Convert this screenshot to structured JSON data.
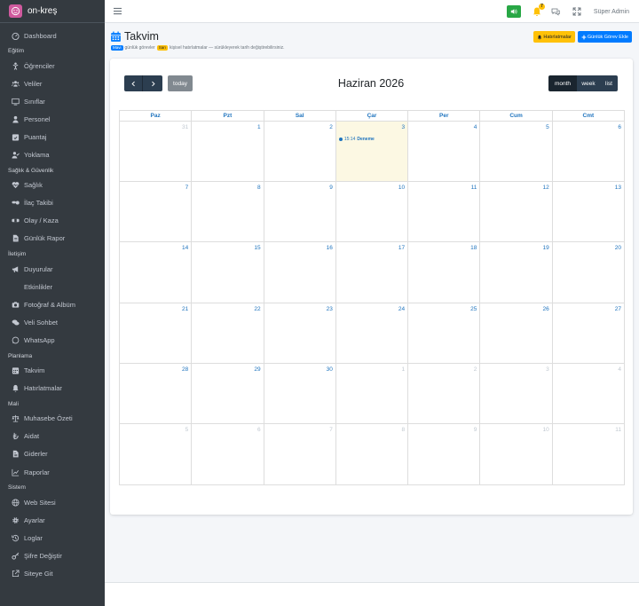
{
  "app": {
    "brand": "on-kreş",
    "user": "Süper Admin",
    "notification_count": "7"
  },
  "sidebar": {
    "sections": [
      {
        "header": "",
        "items": [
          {
            "label": "Dashboard",
            "icon": "dashboard-icon"
          }
        ]
      },
      {
        "header": "Eğitim",
        "items": [
          {
            "label": "Öğrenciler",
            "icon": "child-icon"
          },
          {
            "label": "Veliler",
            "icon": "users-icon"
          },
          {
            "label": "Sınıflar",
            "icon": "chalkboard-icon"
          },
          {
            "label": "Personel",
            "icon": "user-icon"
          },
          {
            "label": "Puantaj",
            "icon": "calendar-check-icon"
          },
          {
            "label": "Yoklama",
            "icon": "user-check-icon"
          }
        ]
      },
      {
        "header": "Sağlık & Güvenlik",
        "items": [
          {
            "label": "Sağlık",
            "icon": "heartbeat-icon"
          },
          {
            "label": "İlaç Takibi",
            "icon": "pills-icon"
          },
          {
            "label": "Olay / Kaza",
            "icon": "bandage-icon"
          },
          {
            "label": "Günlük Rapor",
            "icon": "file-icon"
          }
        ]
      },
      {
        "header": "İletişim",
        "items": [
          {
            "label": "Duyurular",
            "icon": "bullhorn-icon"
          },
          {
            "label": "Etkinlikler",
            "icon": ""
          },
          {
            "label": "Fotoğraf & Albüm",
            "icon": "camera-icon"
          },
          {
            "label": "Veli Sohbet",
            "icon": "comments-icon"
          },
          {
            "label": "WhatsApp",
            "icon": "whatsapp-icon"
          }
        ]
      },
      {
        "header": "Planlama",
        "items": [
          {
            "label": "Takvim",
            "icon": "calendar-icon"
          },
          {
            "label": "Hatırlatmalar",
            "icon": "bell-icon"
          }
        ]
      },
      {
        "header": "Mali",
        "items": [
          {
            "label": "Muhasebe Özeti",
            "icon": "balance-icon"
          },
          {
            "label": "Aidat",
            "icon": "lira-icon"
          },
          {
            "label": "Giderler",
            "icon": "invoice-icon"
          },
          {
            "label": "Raporlar",
            "icon": "chart-icon"
          }
        ]
      },
      {
        "header": "Sistem",
        "items": [
          {
            "label": "Web Sitesi",
            "icon": "globe-icon"
          },
          {
            "label": "Ayarlar",
            "icon": "cog-icon"
          },
          {
            "label": "Loglar",
            "icon": "history-icon"
          },
          {
            "label": "Şifre Değiştir",
            "icon": "key-icon"
          },
          {
            "label": "Siteye Git",
            "icon": "external-link-icon"
          }
        ]
      }
    ]
  },
  "page": {
    "title": "Takvim",
    "subtitle": {
      "tag1": "Mavi",
      "text1": "günlük görevler",
      "tag2": "Sarı",
      "text2": "kişisel hatırlatmalar — sürükleyerek tarih değiştirebilirsiniz."
    },
    "btn_reminders": "Hatırlatmalar",
    "btn_add_task": "Günlük Görev Ekle"
  },
  "calendar": {
    "title": "Haziran 2026",
    "today_label": "today",
    "views": [
      "month",
      "week",
      "list"
    ],
    "weekdays": [
      "Paz",
      "Pzt",
      "Sal",
      "Çar",
      "Per",
      "Cum",
      "Cmt"
    ],
    "weeks": [
      [
        {
          "d": "31",
          "o": true
        },
        {
          "d": "1"
        },
        {
          "d": "2"
        },
        {
          "d": "3",
          "today": true
        },
        {
          "d": "4"
        },
        {
          "d": "5"
        },
        {
          "d": "6"
        }
      ],
      [
        {
          "d": "7"
        },
        {
          "d": "8"
        },
        {
          "d": "9"
        },
        {
          "d": "10"
        },
        {
          "d": "11"
        },
        {
          "d": "12"
        },
        {
          "d": "13"
        }
      ],
      [
        {
          "d": "14"
        },
        {
          "d": "15"
        },
        {
          "d": "16"
        },
        {
          "d": "17"
        },
        {
          "d": "18"
        },
        {
          "d": "19"
        },
        {
          "d": "20"
        }
      ],
      [
        {
          "d": "21"
        },
        {
          "d": "22"
        },
        {
          "d": "23"
        },
        {
          "d": "24"
        },
        {
          "d": "25"
        },
        {
          "d": "26"
        },
        {
          "d": "27"
        }
      ],
      [
        {
          "d": "28"
        },
        {
          "d": "29"
        },
        {
          "d": "30"
        },
        {
          "d": "1",
          "o": true
        },
        {
          "d": "2",
          "o": true
        },
        {
          "d": "3",
          "o": true
        },
        {
          "d": "4",
          "o": true
        }
      ],
      [
        {
          "d": "5",
          "o": true
        },
        {
          "d": "6",
          "o": true
        },
        {
          "d": "7",
          "o": true
        },
        {
          "d": "8",
          "o": true
        },
        {
          "d": "9",
          "o": true
        },
        {
          "d": "10",
          "o": true
        },
        {
          "d": "11",
          "o": true
        }
      ]
    ],
    "events": [
      {
        "week": 0,
        "day": 3,
        "time": "15:14",
        "title": "Deneme"
      }
    ]
  },
  "colors": {
    "sidebar": "#343a40",
    "accent": "#1e73be",
    "today_bg": "#fcf8e3",
    "success": "#28a745",
    "warning": "#ffc107",
    "primary": "#007bff"
  }
}
